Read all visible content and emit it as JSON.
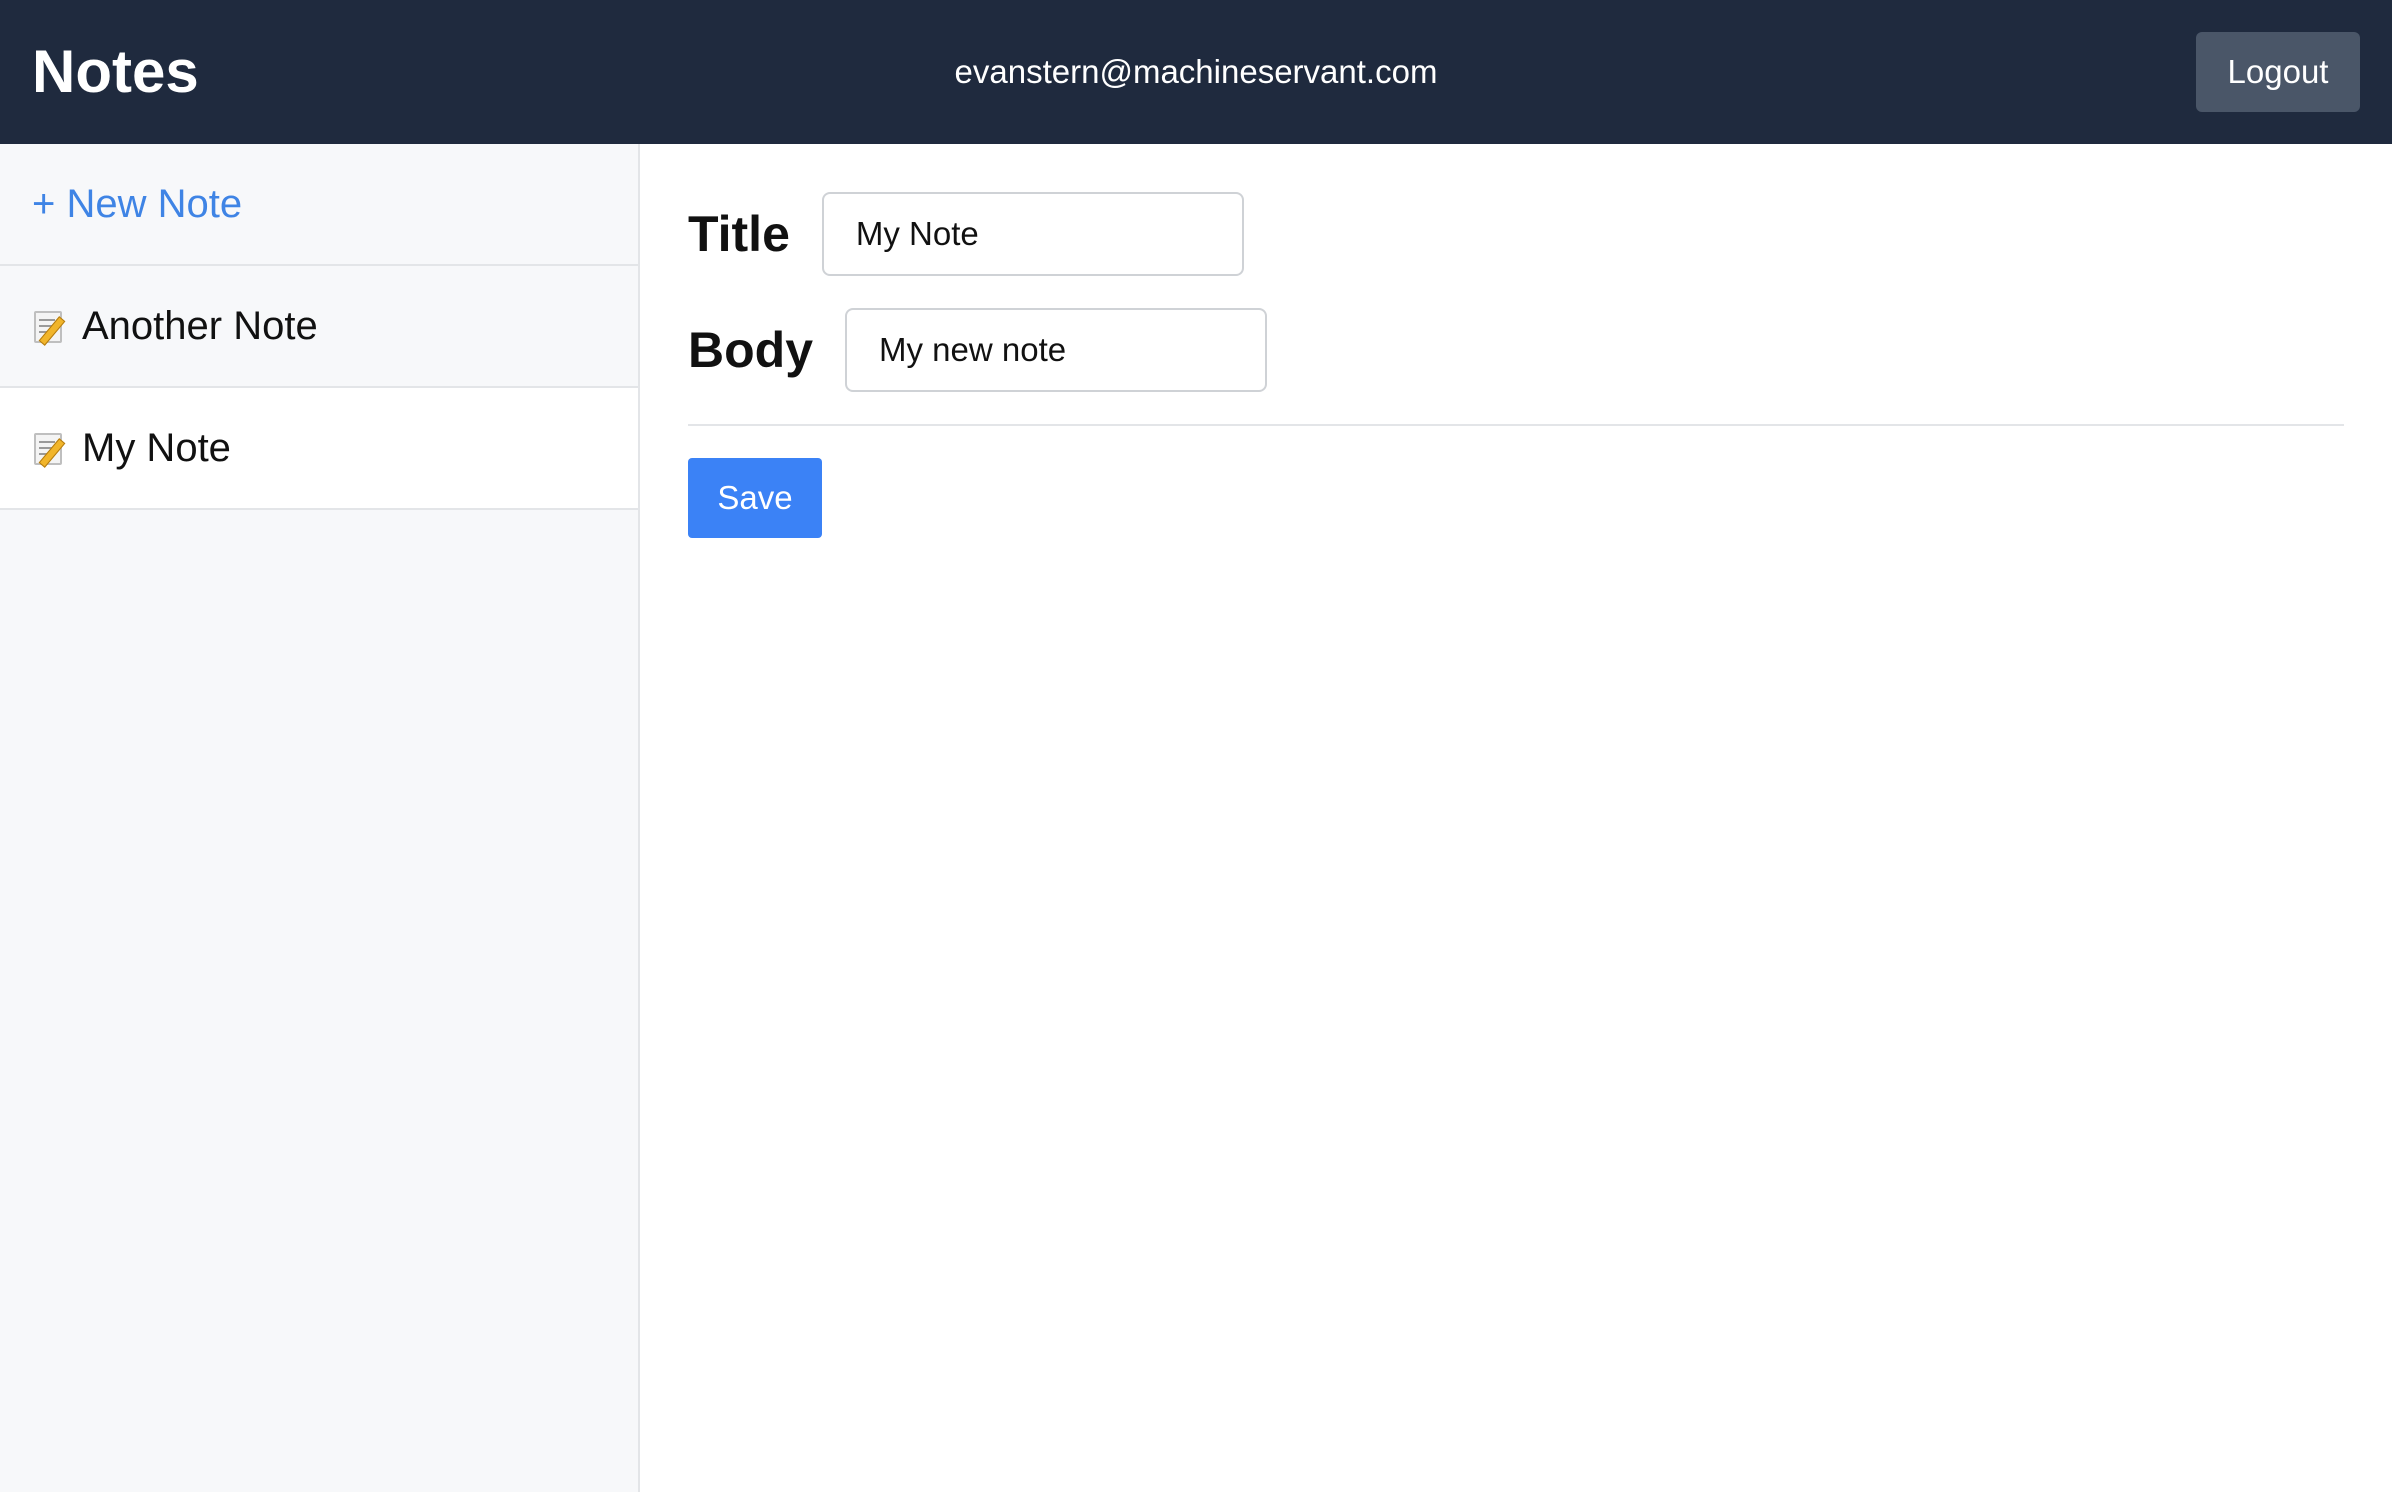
{
  "header": {
    "title": "Notes",
    "user_email": "evanstern@machineservant.com",
    "logout_label": "Logout"
  },
  "sidebar": {
    "new_note_label": "+ New Note",
    "items": [
      {
        "label": "Another Note",
        "icon": "memo-icon",
        "active": false
      },
      {
        "label": "My Note",
        "icon": "memo-icon",
        "active": true
      }
    ]
  },
  "editor": {
    "title_label": "Title",
    "title_value": "My Note",
    "body_label": "Body",
    "body_value": "My new note",
    "save_label": "Save"
  },
  "colors": {
    "header_bg": "#1f2a3e",
    "accent": "#3b82f6",
    "logout_bg": "#4a5668",
    "sidebar_bg": "#f7f8fa"
  }
}
